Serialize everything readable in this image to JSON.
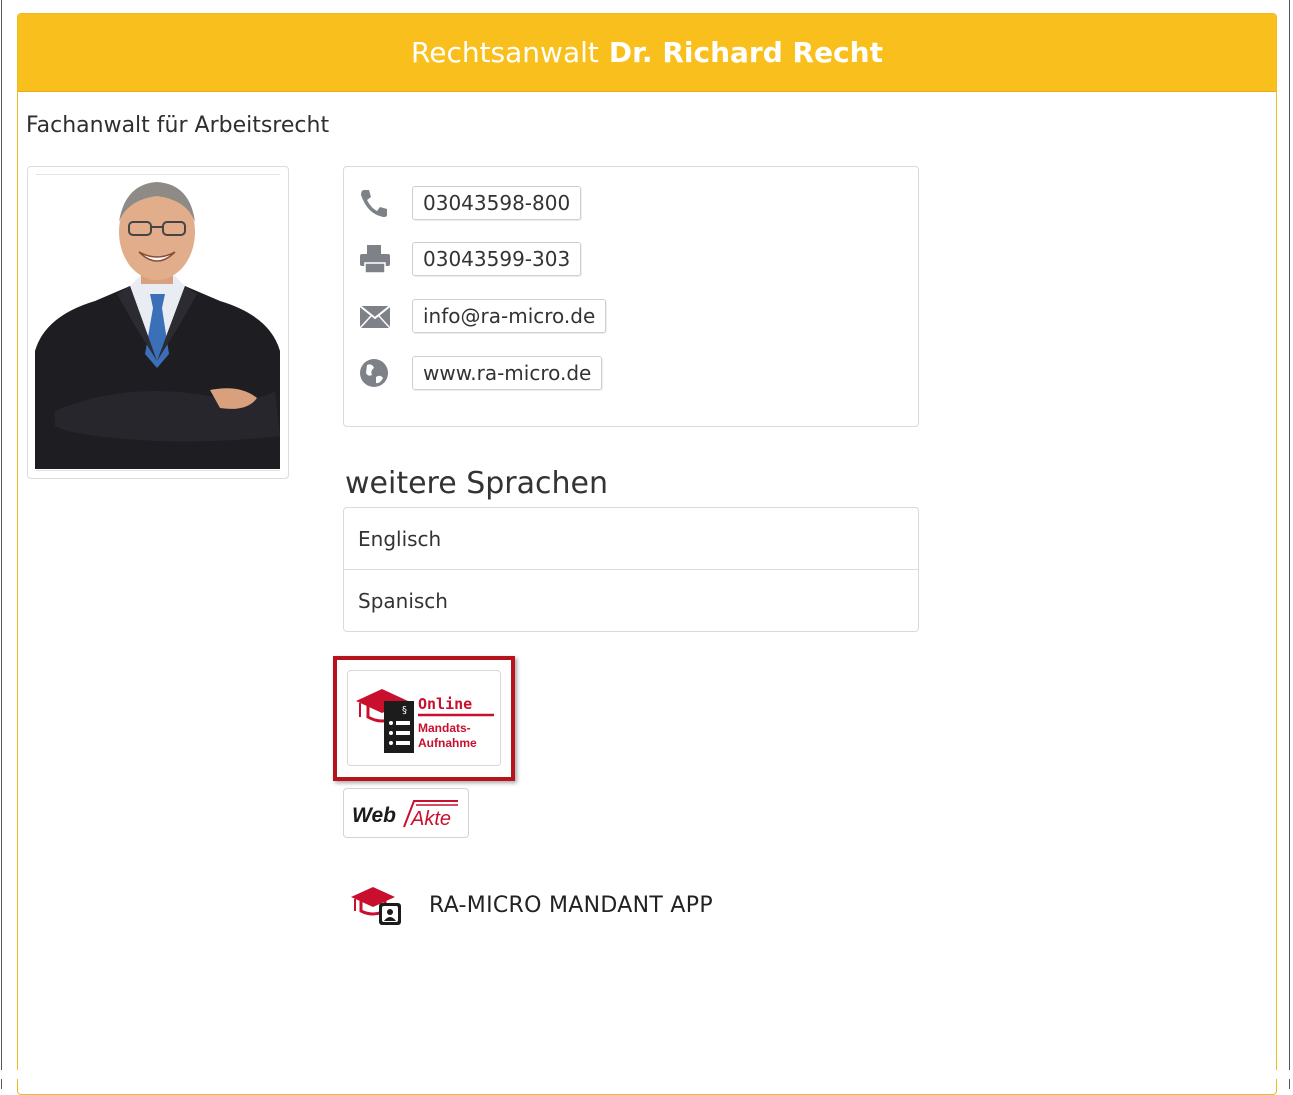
{
  "header": {
    "prefix": "Rechtsanwalt",
    "name": "Dr. Richard Recht"
  },
  "subtitle": "Fachanwalt für Arbeitsrecht",
  "contact": {
    "phone": "03043598-800",
    "fax": "03043599-303",
    "email": "info@ra-micro.de",
    "website": "www.ra-micro.de"
  },
  "languages": {
    "title": "weitere Sprachen",
    "items": [
      "Englisch",
      "Spanisch"
    ]
  },
  "links": {
    "online_badge": {
      "line1": "Online",
      "line2": "Mandats-",
      "line3": "Aufnahme"
    },
    "webakte": {
      "part1": "Web",
      "part2": "Akte"
    },
    "app_label": "RA-MICRO MANDANT APP"
  },
  "colors": {
    "header_bg": "#f9c01d",
    "accent_red": "#c8102e",
    "highlight_border": "#b5141c"
  }
}
